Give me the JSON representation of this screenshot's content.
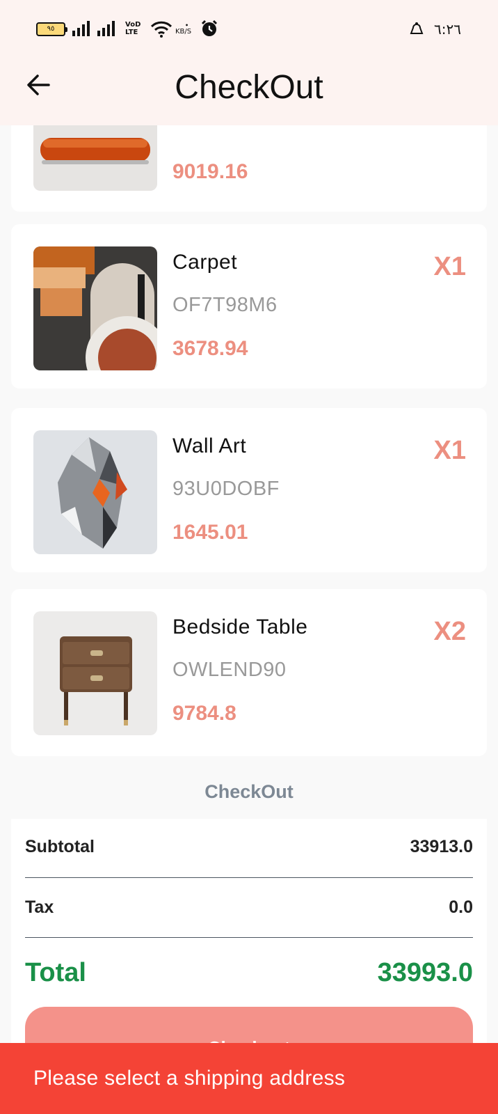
{
  "status_bar": {
    "battery_level": "٩٥",
    "volte_line1": "VoD",
    "volte_line2": "LTE",
    "net_speed_unit": "KB/S",
    "time": "٦:٢٦",
    "icons": [
      "battery-icon",
      "signal-icon",
      "volte-icon",
      "wifi-icon",
      "alarm-icon",
      "notification-icon"
    ]
  },
  "header": {
    "title": "CheckOut",
    "back_icon": "arrow-left-icon"
  },
  "items": [
    {
      "name": "",
      "code": "",
      "price": "9019.16",
      "qty": ""
    },
    {
      "name": "Carpet",
      "code": "OF7T98M6",
      "price": "3678.94",
      "qty": "X1"
    },
    {
      "name": "Wall Art",
      "code": "93U0DOBF",
      "price": "1645.01",
      "qty": "X1"
    },
    {
      "name": "Bedside Table",
      "code": "OWLEND90",
      "price": "9784.8",
      "qty": "X2"
    }
  ],
  "summary": {
    "section_title": "CheckOut",
    "subtotal_label": "Subtotal",
    "subtotal_value": "33913.0",
    "tax_label": "Tax",
    "tax_value": "0.0",
    "total_label": "Total",
    "total_value": "33993.0"
  },
  "checkout_button": {
    "label": "Checkout"
  },
  "snackbar": {
    "message": "Please select a shipping address"
  },
  "colors": {
    "accent": "#ec8f80",
    "total_green": "#1a9048",
    "snackbar_red": "#f44336",
    "header_bg": "#fdf3f1",
    "button": "#f4928a"
  }
}
